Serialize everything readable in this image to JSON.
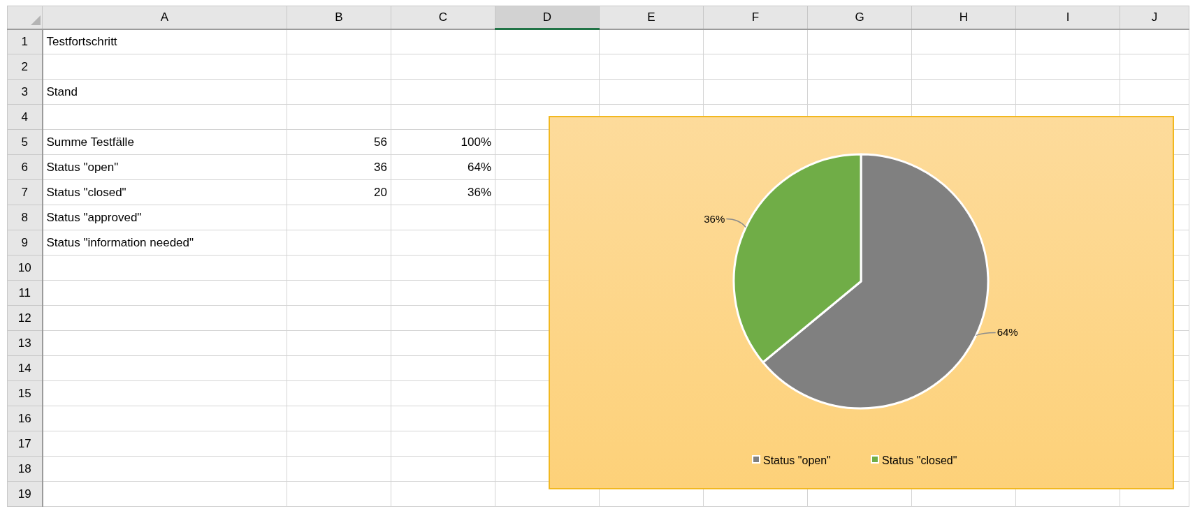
{
  "columns": [
    {
      "label": "A",
      "selected": false
    },
    {
      "label": "B",
      "selected": false
    },
    {
      "label": "C",
      "selected": false
    },
    {
      "label": "D",
      "selected": true
    },
    {
      "label": "E",
      "selected": false
    },
    {
      "label": "F",
      "selected": false
    },
    {
      "label": "G",
      "selected": false
    },
    {
      "label": "H",
      "selected": false
    },
    {
      "label": "I",
      "selected": false
    },
    {
      "label": "J",
      "selected": false
    }
  ],
  "rows": [
    {
      "number": "1",
      "cells": {
        "A": "Testfortschritt"
      }
    },
    {
      "number": "2"
    },
    {
      "number": "3",
      "cells": {
        "A": "Stand"
      }
    },
    {
      "number": "4"
    },
    {
      "number": "5",
      "cells": {
        "A": "Summe Testfälle",
        "B": "56",
        "C": "100%"
      }
    },
    {
      "number": "6",
      "cells": {
        "A": "Status \"open\"",
        "B": "36",
        "C": "64%"
      }
    },
    {
      "number": "7",
      "cells": {
        "A": "Status \"closed\"",
        "B": "20",
        "C": "36%"
      }
    },
    {
      "number": "8",
      "cells": {
        "A": "Status \"approved\""
      }
    },
    {
      "number": "9",
      "cells": {
        "A": "Status \"information needed\""
      }
    },
    {
      "number": "10"
    },
    {
      "number": "11"
    },
    {
      "number": "12"
    },
    {
      "number": "13"
    },
    {
      "number": "14"
    },
    {
      "number": "15"
    },
    {
      "number": "16"
    },
    {
      "number": "17"
    },
    {
      "number": "18"
    },
    {
      "number": "19"
    }
  ],
  "chart": {
    "chart_data": {
      "type": "pie",
      "categories": [
        "Status \"open\"",
        "Status \"closed\""
      ],
      "values": [
        64,
        36
      ],
      "value_labels": [
        "64%",
        "36%"
      ],
      "legend": "bottom"
    },
    "slices": [
      {
        "color": "#808080"
      },
      {
        "color": "#70ad47"
      }
    ]
  }
}
